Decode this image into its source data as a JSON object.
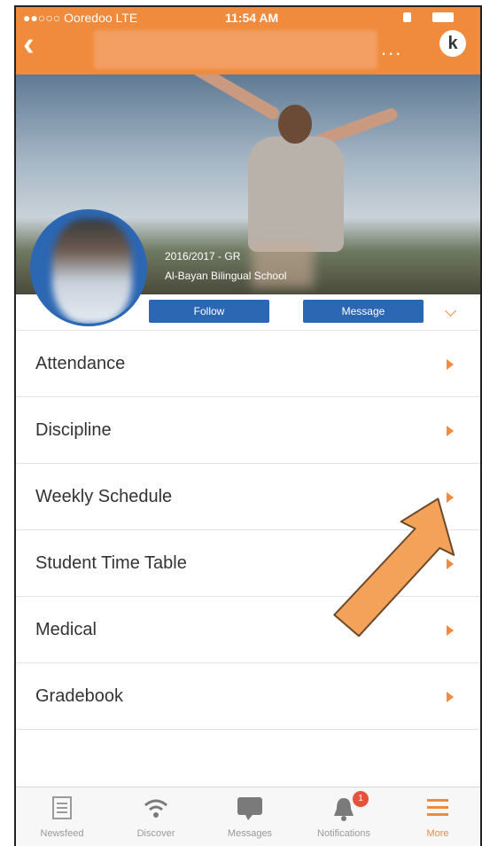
{
  "status_bar": {
    "carrier": "●●○○○ Ooredoo  LTE",
    "time": "11:54 AM"
  },
  "header": {
    "more_dots": "...",
    "logo_letter": "k"
  },
  "profile": {
    "cover_line1": "2016/2017 - GR",
    "cover_line2": "Al-Bayan Bilingual School",
    "follow_label": "Follow",
    "message_label": "Message"
  },
  "menu": {
    "items": [
      {
        "label": "Attendance"
      },
      {
        "label": "Discipline"
      },
      {
        "label": "Weekly Schedule"
      },
      {
        "label": "Student Time Table"
      },
      {
        "label": "Medical"
      },
      {
        "label": "Gradebook"
      }
    ]
  },
  "tabbar": {
    "tabs": [
      {
        "label": "Newsfeed",
        "icon": "newsfeed-icon"
      },
      {
        "label": "Discover",
        "icon": "wifi-icon"
      },
      {
        "label": "Messages",
        "icon": "chat-bubble-icon"
      },
      {
        "label": "Notifications",
        "icon": "bell-icon",
        "badge": "1"
      },
      {
        "label": "More",
        "icon": "menu-lines-icon"
      }
    ]
  },
  "colors": {
    "accent": "#f08a3c",
    "button_blue": "#2c67b4",
    "badge_red": "#e5533d"
  }
}
